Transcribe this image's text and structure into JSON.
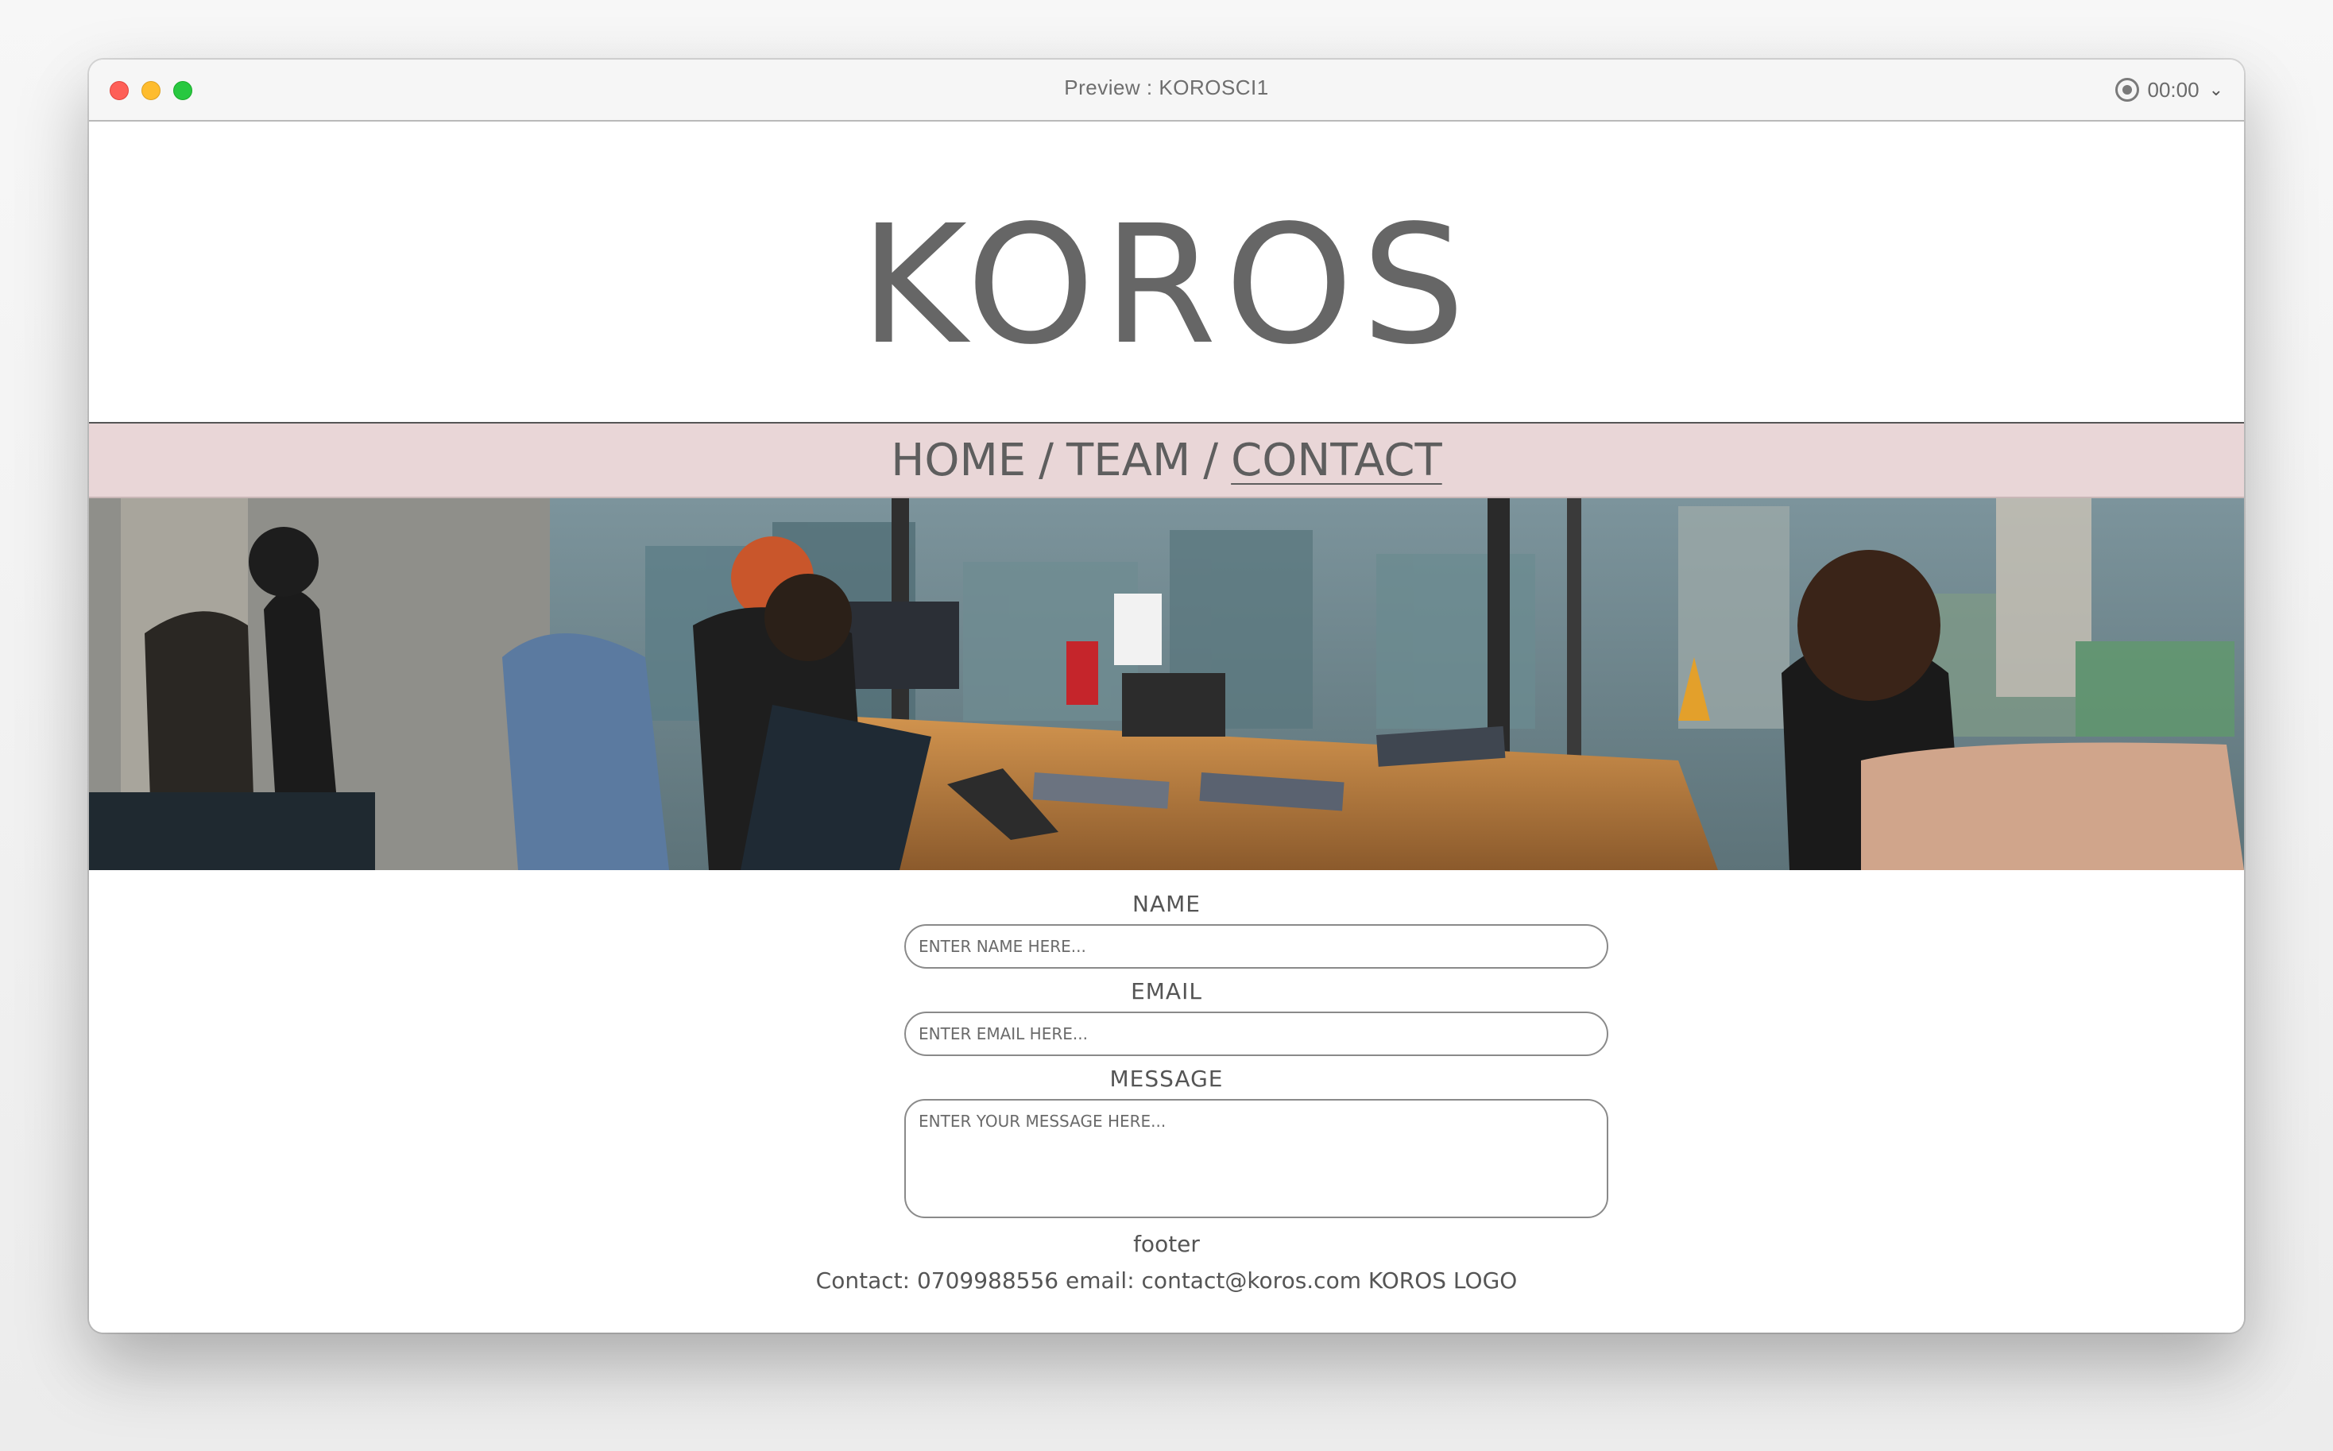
{
  "window": {
    "title": "Preview : KOROSCI1",
    "recording_time": "00:00"
  },
  "header": {
    "logo_text": "KOROS"
  },
  "nav": {
    "items": [
      {
        "label": "HOME"
      },
      {
        "label": "TEAM"
      },
      {
        "label": "CONTACT"
      }
    ],
    "separator": "/",
    "active": "CONTACT"
  },
  "form": {
    "name_label": "NAME",
    "name_placeholder": "ENTER NAME HERE...",
    "email_label": "EMAIL",
    "email_placeholder": "ENTER EMAIL HERE...",
    "message_label": "MESSAGE",
    "message_placeholder": "ENTER YOUR MESSAGE HERE..."
  },
  "footer": {
    "title": "footer",
    "text": "Contact: 0709988556 email: contact@koros.com KOROS LOGO"
  },
  "colors": {
    "nav_background": "#e9d6d7",
    "text_gray": "#666666"
  }
}
